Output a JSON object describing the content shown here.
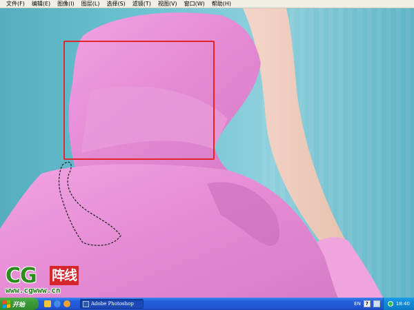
{
  "menubar": {
    "items": [
      {
        "label": "文件(F)"
      },
      {
        "label": "编辑(E)"
      },
      {
        "label": "图像(I)"
      },
      {
        "label": "图层(L)"
      },
      {
        "label": "选择(S)"
      },
      {
        "label": "滤镜(T)"
      },
      {
        "label": "视图(V)"
      },
      {
        "label": "窗口(W)"
      },
      {
        "label": "帮助(H)"
      }
    ]
  },
  "watermark": {
    "cg": "CG",
    "zhenxian": "阵线",
    "url": "www.cgwww.cn"
  },
  "taskbar": {
    "start_label": "开始",
    "task_label": "Adobe Photoshop",
    "lang": "EN",
    "clock": "18:40"
  },
  "colors": {
    "background": "#6fbfcf",
    "dress": "#e68fd6",
    "selection": "#e0252b",
    "taskbar": "#245edb"
  }
}
